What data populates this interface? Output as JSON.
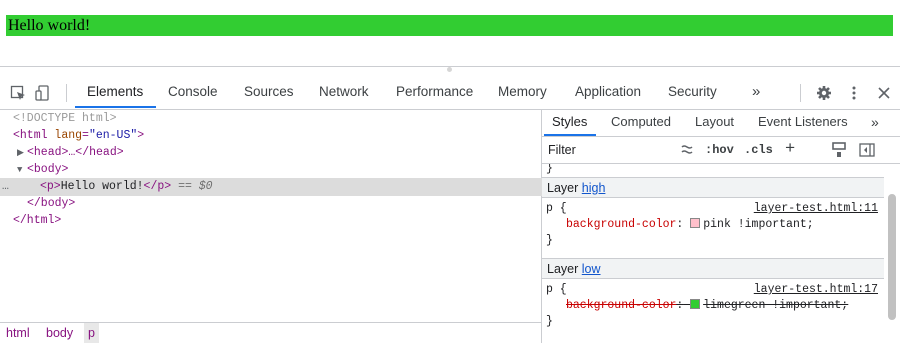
{
  "page": {
    "text": "Hello world!",
    "highlight_color": "#32cd32"
  },
  "toolbar": {
    "tabs": [
      "Elements",
      "Console",
      "Sources",
      "Network",
      "Performance",
      "Memory",
      "Application",
      "Security"
    ],
    "more_tabs": "»",
    "icons": [
      "inspect-element-icon",
      "device-toolbar-icon",
      "gear-icon",
      "kebab-menu-icon",
      "close-icon"
    ]
  },
  "elements": {
    "doctype": "<!DOCTYPE html>",
    "html_open_tag": "<html",
    "html_attr_name": "lang",
    "html_attr_eq": "=",
    "html_attr_value": "\"en-US\"",
    "html_open_close": ">",
    "head_collapsed": "<head>…</head>",
    "body_open": "<body>",
    "p_open": "<p>",
    "p_text": "Hello world!",
    "p_close": "</p>",
    "selected_ref": "== $0",
    "body_close": "</body>",
    "html_close": "</html>",
    "ellipsis": "…"
  },
  "breadcrumbs": [
    "html",
    "body",
    "p"
  ],
  "styles": {
    "sub_tabs": [
      "Styles",
      "Computed",
      "Layout",
      "Event Listeners"
    ],
    "more": "»",
    "filter_placeholder": "Filter",
    "hov": ":hov",
    "cls": ".cls",
    "plus": "+",
    "closing_brace_top": "}",
    "layers": [
      {
        "label": "Layer",
        "name": "high",
        "selector": "p {",
        "source": "layer-test.html:11",
        "property": "background-color",
        "colon": ":",
        "value": "pink !important;",
        "swatch": "#ffc0cb",
        "struck": false,
        "close": "}"
      },
      {
        "label": "Layer",
        "name": "low",
        "selector": "p {",
        "source": "layer-test.html:17",
        "property": "background-color",
        "colon": ":",
        "value": "limegreen !important;",
        "swatch": "#32cd32",
        "struck": true,
        "close": "}"
      }
    ]
  }
}
